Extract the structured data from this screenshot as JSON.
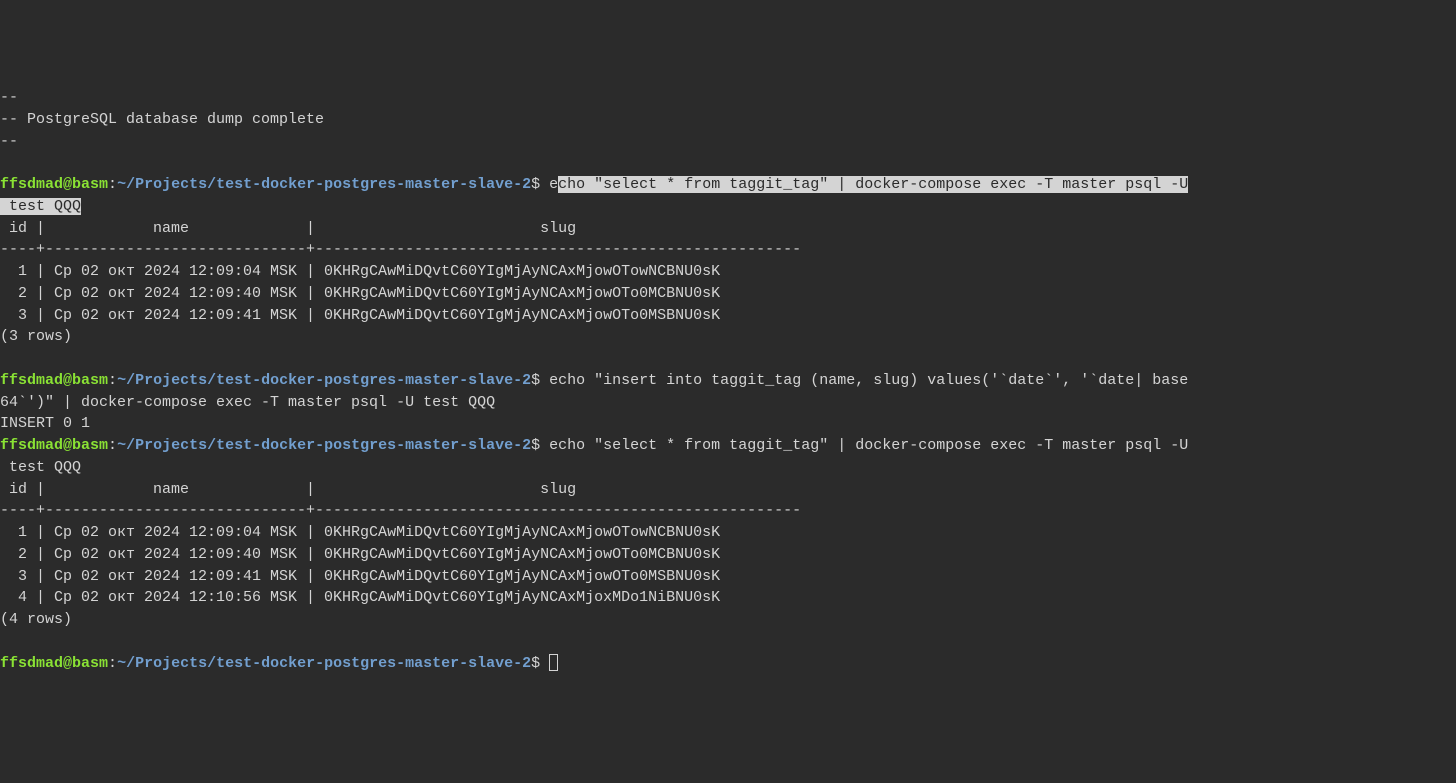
{
  "top_fragment_line1": "--",
  "top_fragment_line2": "-- PostgreSQL database dump complete",
  "top_fragment_line3": "--",
  "prompt": {
    "user": "ffsdmad",
    "at": "@",
    "host": "basm",
    "colon": ":",
    "path": "~/Projects/test-docker-postgres-master-slave-2",
    "dollar": "$"
  },
  "block1": {
    "cmd_prefix": " e",
    "cmd_highlighted": "cho \"select * from taggit_tag\" | docker-compose exec -T master psql -U",
    "cmd_line2_highlighted": " test QQQ",
    "header": " id |            name             |                         slug",
    "separator": "----+-----------------------------+------------------------------------------------------",
    "row1": "  1 | Ср 02 окт 2024 12:09:04 MSK | 0KHRgCAwMiDQvtC60YIgMjAyNCAxMjowOTowNCBNU0sK",
    "row2": "  2 | Ср 02 окт 2024 12:09:40 MSK | 0KHRgCAwMiDQvtC60YIgMjAyNCAxMjowOTo0MCBNU0sK",
    "row3": "  3 | Ср 02 окт 2024 12:09:41 MSK | 0KHRgCAwMiDQvtC60YIgMjAyNCAxMjowOTo0MSBNU0sK",
    "footer": "(3 rows)"
  },
  "block2": {
    "cmd_line1": " echo \"insert into taggit_tag (name, slug) values('`date`', '`date| base",
    "cmd_line2": "64`')\" | docker-compose exec -T master psql -U test QQQ",
    "result": "INSERT 0 1"
  },
  "block3": {
    "cmd_line1": " echo \"select * from taggit_tag\" | docker-compose exec -T master psql -U",
    "cmd_line2": " test QQQ",
    "header": " id |            name             |                         slug",
    "separator": "----+-----------------------------+------------------------------------------------------",
    "row1": "  1 | Ср 02 окт 2024 12:09:04 MSK | 0KHRgCAwMiDQvtC60YIgMjAyNCAxMjowOTowNCBNU0sK",
    "row2": "  2 | Ср 02 окт 2024 12:09:40 MSK | 0KHRgCAwMiDQvtC60YIgMjAyNCAxMjowOTo0MCBNU0sK",
    "row3": "  3 | Ср 02 окт 2024 12:09:41 MSK | 0KHRgCAwMiDQvtC60YIgMjAyNCAxMjowOTo0MSBNU0sK",
    "row4": "  4 | Ср 02 окт 2024 12:10:56 MSK | 0KHRgCAwMiDQvtC60YIgMjAyNCAxMjoxMDo1NiBNU0sK",
    "footer": "(4 rows)"
  },
  "final_prompt_suffix": " "
}
